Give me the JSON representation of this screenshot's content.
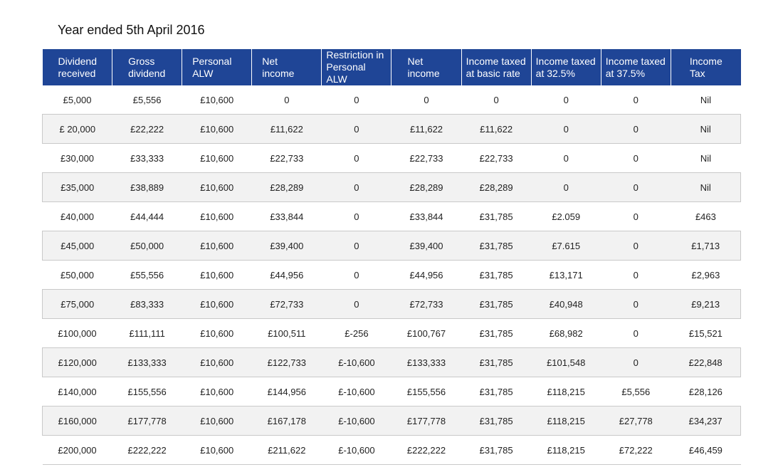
{
  "title": "Year ended 5th April 2016",
  "headers": [
    [
      "Dividend",
      "received"
    ],
    [
      "Gross",
      "dividend"
    ],
    [
      "Personal",
      "ALW"
    ],
    [
      "Net",
      "income"
    ],
    [
      "Restriction in",
      "Personal ALW"
    ],
    [
      "Net",
      "income"
    ],
    [
      "Income taxed",
      "at basic rate"
    ],
    [
      "Income taxed",
      "at 32.5%"
    ],
    [
      "Income taxed",
      "at 37.5%"
    ],
    [
      "Income",
      "Tax"
    ]
  ],
  "rows": [
    [
      "£5,000",
      "£5,556",
      "£10,600",
      "0",
      "0",
      "0",
      "0",
      "0",
      "0",
      "Nil"
    ],
    [
      "£ 20,000",
      "£22,222",
      "£10,600",
      "£11,622",
      "0",
      "£11,622",
      "£11,622",
      "0",
      "0",
      "Nil"
    ],
    [
      "£30,000",
      "£33,333",
      "£10,600",
      "£22,733",
      "0",
      "£22,733",
      "£22,733",
      "0",
      "0",
      "Nil"
    ],
    [
      "£35,000",
      "£38,889",
      "£10,600",
      "£28,289",
      "0",
      "£28,289",
      "£28,289",
      "0",
      "0",
      "Nil"
    ],
    [
      "£40,000",
      "£44,444",
      "£10,600",
      "£33,844",
      "0",
      "£33,844",
      "£31,785",
      "£2.059",
      "0",
      "£463"
    ],
    [
      "£45,000",
      "£50,000",
      "£10,600",
      "£39,400",
      "0",
      "£39,400",
      "£31,785",
      "£7.615",
      "0",
      "£1,713"
    ],
    [
      "£50,000",
      "£55,556",
      "£10,600",
      "£44,956",
      "0",
      "£44,956",
      "£31,785",
      "£13,171",
      "0",
      "£2,963"
    ],
    [
      "£75,000",
      "£83,333",
      "£10,600",
      "£72,733",
      "0",
      "£72,733",
      "£31,785",
      "£40,948",
      "0",
      "£9,213"
    ],
    [
      "£100,000",
      "£111,111",
      "£10,600",
      "£100,511",
      "£-256",
      "£100,767",
      "£31,785",
      "£68,982",
      "0",
      "£15,521"
    ],
    [
      "£120,000",
      "£133,333",
      "£10,600",
      "£122,733",
      "£-10,600",
      "£133,333",
      "£31,785",
      "£101,548",
      "0",
      "£22,848"
    ],
    [
      "£140,000",
      "£155,556",
      "£10,600",
      "£144,956",
      "£-10,600",
      "£155,556",
      "£31,785",
      "£118,215",
      "£5,556",
      "£28,126"
    ],
    [
      "£160,000",
      "£177,778",
      "£10,600",
      "£167,178",
      "£-10,600",
      "£177,778",
      "£31,785",
      "£118,215",
      "£27,778",
      "£34,237"
    ],
    [
      "£200,000",
      "£222,222",
      "£10,600",
      "£211,622",
      "£-10,600",
      "£222,222",
      "£31,785",
      "£118,215",
      "£72,222",
      "£46,459"
    ]
  ],
  "colors": {
    "header_bg": "#1f4596",
    "header_text": "#ffffff",
    "alt_row_bg": "#f2f2f2",
    "row_border": "#c9c9c9"
  }
}
